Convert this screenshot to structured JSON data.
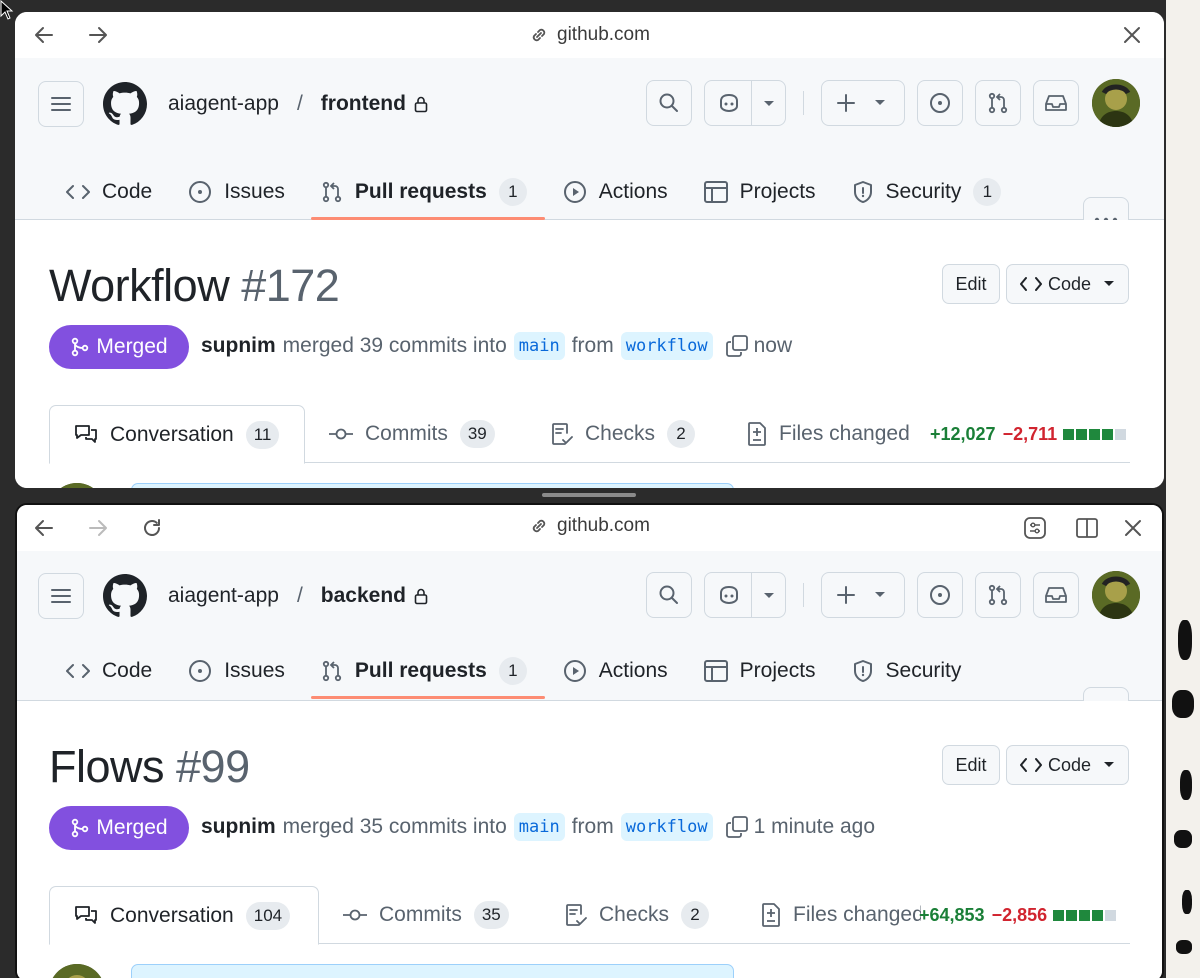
{
  "colors": {
    "merged": "#8250df",
    "tab_underline": "#fd8c73",
    "additions": "#1a7f37",
    "deletions": "#d1242f",
    "branch_text": "#0969da",
    "branch_bg": "#ddf4ff"
  },
  "windows": [
    {
      "browser": {
        "url": "github.com",
        "nav_icons": [
          "back-arrow-icon",
          "forward-arrow-icon"
        ],
        "right_icons": [
          "close-icon"
        ]
      },
      "repo": {
        "owner": "aiagent-app",
        "separator": "/",
        "name": "frontend"
      },
      "repo_tabs": [
        {
          "label": "Code",
          "icon": "code-icon"
        },
        {
          "label": "Issues",
          "icon": "issue-icon"
        },
        {
          "label": "Pull requests",
          "icon": "pull-request-icon",
          "count": "1",
          "active": true
        },
        {
          "label": "Actions",
          "icon": "play-icon"
        },
        {
          "label": "Projects",
          "icon": "table-icon"
        },
        {
          "label": "Security",
          "icon": "shield-icon",
          "count": "1"
        }
      ],
      "pr": {
        "title": "Workflow",
        "number": "#172",
        "edit_label": "Edit",
        "code_label": "Code",
        "state": "Merged",
        "author": "supnim",
        "merge_text": "merged 39 commits into",
        "base": "main",
        "from_text": "from",
        "head": "workflow",
        "time": "now"
      },
      "pr_tabs": [
        {
          "label": "Conversation",
          "count": "11",
          "active": true
        },
        {
          "label": "Commits",
          "count": "39"
        },
        {
          "label": "Checks",
          "count": "2"
        },
        {
          "label": "Files changed"
        }
      ],
      "diffstat": {
        "additions": "+12,027",
        "deletions": "−2,711",
        "blocks": [
          1,
          1,
          1,
          1,
          0
        ]
      }
    },
    {
      "browser": {
        "url": "github.com",
        "nav_icons": [
          "back-arrow-icon",
          "forward-arrow-icon",
          "reload-icon"
        ],
        "right_icons": [
          "sliders-icon",
          "split-view-icon",
          "close-icon"
        ]
      },
      "repo": {
        "owner": "aiagent-app",
        "separator": "/",
        "name": "backend"
      },
      "repo_tabs": [
        {
          "label": "Code",
          "icon": "code-icon"
        },
        {
          "label": "Issues",
          "icon": "issue-icon"
        },
        {
          "label": "Pull requests",
          "icon": "pull-request-icon",
          "count": "1",
          "active": true
        },
        {
          "label": "Actions",
          "icon": "play-icon"
        },
        {
          "label": "Projects",
          "icon": "table-icon"
        },
        {
          "label": "Security",
          "icon": "shield-icon"
        }
      ],
      "pr": {
        "title": "Flows",
        "number": "#99",
        "edit_label": "Edit",
        "code_label": "Code",
        "state": "Merged",
        "author": "supnim",
        "merge_text": "merged 35 commits into",
        "base": "main",
        "from_text": "from",
        "head": "workflow",
        "time": "1 minute ago"
      },
      "pr_tabs": [
        {
          "label": "Conversation",
          "count": "104",
          "active": true
        },
        {
          "label": "Commits",
          "count": "35"
        },
        {
          "label": "Checks",
          "count": "2"
        },
        {
          "label": "Files changed"
        }
      ],
      "diffstat": {
        "additions": "+64,853",
        "deletions": "−2,856",
        "blocks": [
          1,
          1,
          1,
          1,
          0
        ]
      }
    }
  ]
}
